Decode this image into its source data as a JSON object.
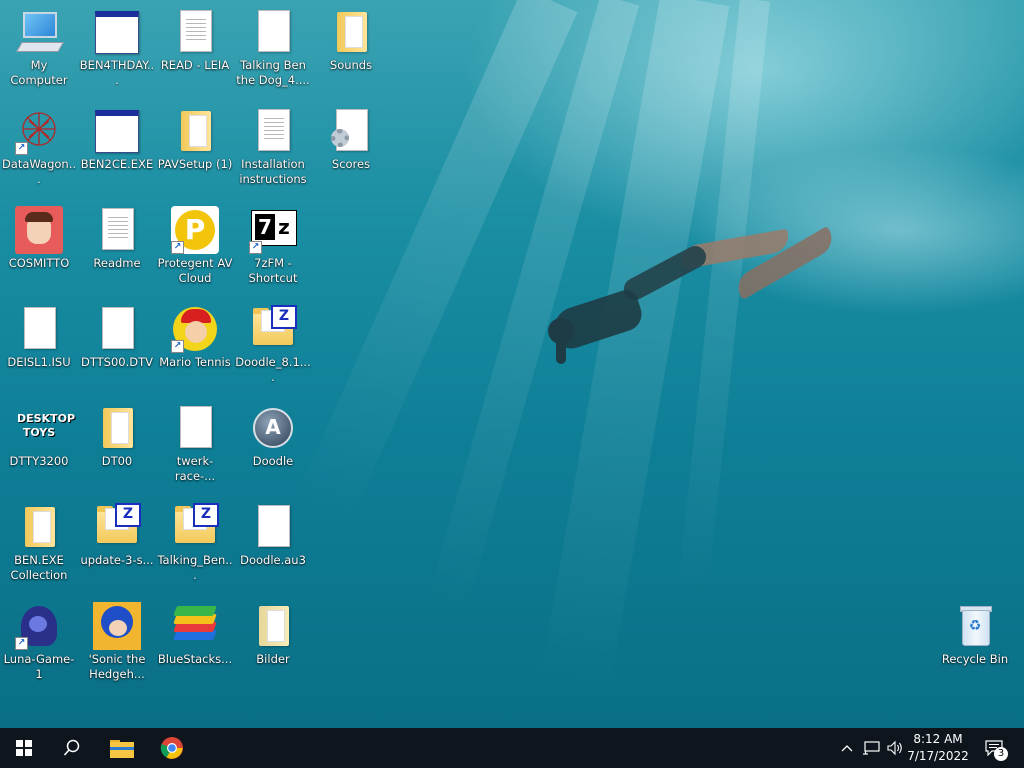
{
  "desktop": {
    "icons": [
      {
        "label": "My Computer",
        "icon": "computer-icon"
      },
      {
        "label": "BEN4THDAY...",
        "icon": "app-window-icon"
      },
      {
        "label": "READ - LEIA",
        "icon": "text-document-icon"
      },
      {
        "label": "Talking Ben the Dog_4....",
        "icon": "blank-file-icon"
      },
      {
        "label": "Sounds",
        "icon": "folder-icon"
      },
      {
        "label": "DataWagon...",
        "icon": "datawagon-app-icon"
      },
      {
        "label": "BEN2CE.EXE",
        "icon": "app-window-icon"
      },
      {
        "label": "PAVSetup (1)",
        "icon": "folder-icon"
      },
      {
        "label": "Installation instructions",
        "icon": "text-document-icon"
      },
      {
        "label": "Scores",
        "icon": "settings-file-icon"
      },
      {
        "label": "COSMITTO",
        "icon": "avatar-app-icon"
      },
      {
        "label": "Readme",
        "icon": "text-document-icon"
      },
      {
        "label": "Protegent AV Cloud",
        "icon": "protegent-app-icon"
      },
      {
        "label": "7zFM - Shortcut",
        "icon": "7zip-app-icon"
      },
      {
        "label": "DEISL1.ISU",
        "icon": "blank-file-icon"
      },
      {
        "label": "DTTS00.DTV",
        "icon": "blank-file-icon"
      },
      {
        "label": "Mario Tennis",
        "icon": "mario-app-icon"
      },
      {
        "label": "Doodle_8.1....",
        "icon": "zip-folder-icon"
      },
      {
        "label": "DTTY3200",
        "icon": "desktop-toys-icon"
      },
      {
        "label": "DT00",
        "icon": "folder-icon"
      },
      {
        "label": "twerk-race-...",
        "icon": "blank-file-icon"
      },
      {
        "label": "Doodle",
        "icon": "autoit-app-icon"
      },
      {
        "label": "BEN.EXE Collection",
        "icon": "folder-icon"
      },
      {
        "label": "update-3-s...",
        "icon": "zip-folder-icon"
      },
      {
        "label": "Talking_Ben...",
        "icon": "zip-folder-icon"
      },
      {
        "label": "Doodle.au3",
        "icon": "blank-file-icon"
      },
      {
        "label": "Luna-Game-1",
        "icon": "luna-game-icon"
      },
      {
        "label": "'Sonic the Hedgeh...",
        "icon": "sonic-app-icon"
      },
      {
        "label": "BlueStacks...",
        "icon": "bluestacks-app-icon"
      },
      {
        "label": "Bilder",
        "icon": "folder-icon"
      },
      {
        "label": "Recycle Bin",
        "icon": "recycle-bin-icon"
      }
    ]
  },
  "taskbar": {
    "start": "start-windows-icon",
    "search": "search-icon",
    "pinned": [
      "file-explorer-icon",
      "chrome-icon"
    ],
    "tray_icons": [
      "chevron-up-icon",
      "network-icon",
      "volume-icon"
    ],
    "clock": {
      "time": "8:12 AM",
      "date": "7/17/2022"
    },
    "notifications": {
      "count": "3"
    }
  },
  "colors": {
    "taskbar": "#0e151c",
    "water": "#1a8ea3",
    "label_text": "#ffffff"
  }
}
